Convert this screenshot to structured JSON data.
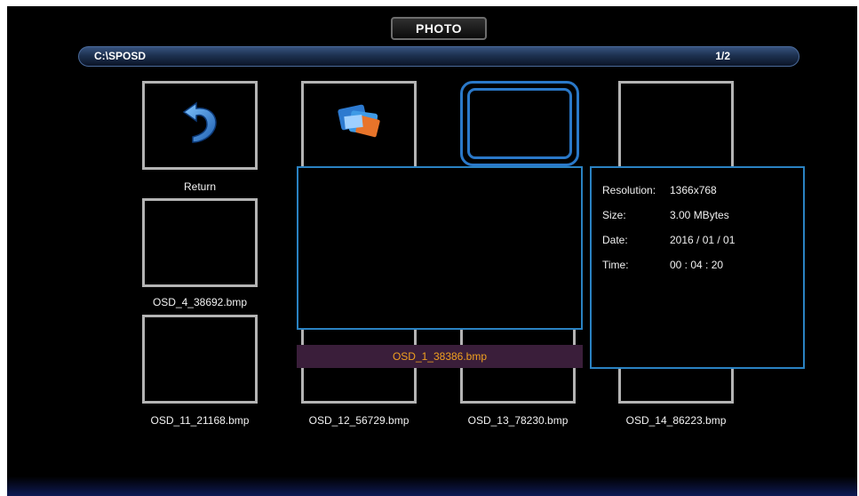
{
  "header": {
    "title": "PHOTO"
  },
  "path_bar": {
    "path": "C:\\SPOSD",
    "page": "1/2"
  },
  "items": {
    "return": "Return",
    "osd_4": "OSD_4_38692.bmp",
    "osd_11": "OSD_11_21168.bmp",
    "osd_12": "OSD_12_56729.bmp",
    "osd_13": "OSD_13_78230.bmp",
    "osd_14": "OSD_14_86223.bmp"
  },
  "selected_filename": "OSD_1_38386.bmp",
  "info": {
    "resolution_label": "Resolution:",
    "resolution": "1366x768",
    "size_label": "Size:",
    "size": "3.00 MBytes",
    "date_label": "Date:",
    "date": "2016 / 01 / 01",
    "time_label": "Time:",
    "time": "00 : 04 : 20"
  },
  "icons": {
    "return": "return-arrow-icon",
    "folder": "folder-photos-icon"
  },
  "colors": {
    "accent": "#2a82c2",
    "highlight_text": "#f0a020",
    "filename_bg": "#3a1e3a"
  }
}
